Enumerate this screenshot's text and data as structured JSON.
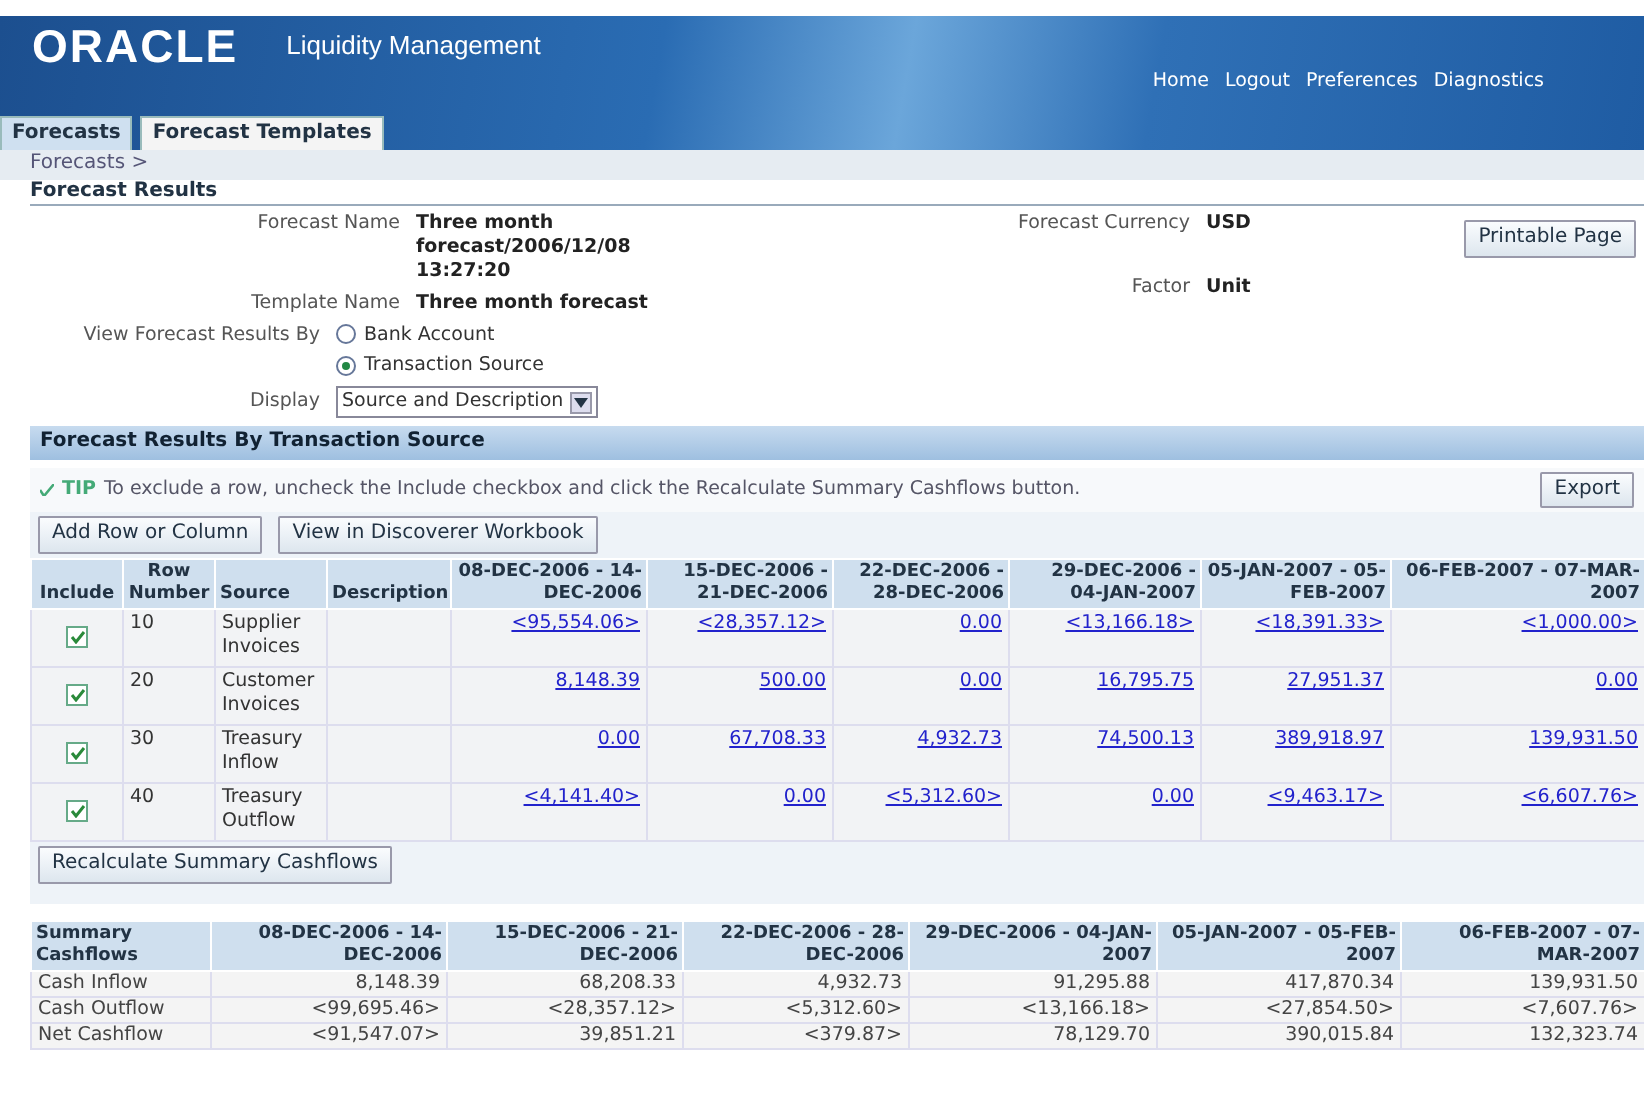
{
  "header": {
    "logo": "ORACLE",
    "app_title": "Liquidity Management",
    "global_links": [
      "Home",
      "Logout",
      "Preferences",
      "Diagnostics"
    ]
  },
  "tabs": [
    {
      "label": "Forecasts",
      "selected": true
    },
    {
      "label": "Forecast Templates",
      "selected": false
    }
  ],
  "breadcrumb": "Forecasts >",
  "page_title": "Forecast Results",
  "details": {
    "left": [
      {
        "label": "Forecast Name",
        "value": "Three month forecast/2006/12/08 13:27:20"
      },
      {
        "label": "Template Name",
        "value": "Three month forecast"
      }
    ],
    "right": [
      {
        "label": "Forecast Currency",
        "value": "USD"
      },
      {
        "label": "Factor",
        "value": "Unit"
      }
    ],
    "printable_button": "Printable Page",
    "view_by": {
      "label": "View Forecast Results By",
      "options": [
        {
          "label": "Bank Account",
          "selected": false
        },
        {
          "label": "Transaction Source",
          "selected": true
        }
      ]
    },
    "display": {
      "label": "Display",
      "value": "Source and Description"
    }
  },
  "section": {
    "title": "Forecast Results By Transaction Source",
    "tip_label": "TIP",
    "tip": "To exclude a row, uncheck the Include checkbox and click the Recalculate Summary Cashflows button.",
    "export_button": "Export",
    "buttons": [
      "Add Row or Column",
      "View in Discoverer Workbook"
    ],
    "table": {
      "columns": [
        "Include",
        "Row Number",
        "Source",
        "Description",
        "08-DEC-2006 - 14-DEC-2006",
        "15-DEC-2006 - 21-DEC-2006",
        "22-DEC-2006 - 28-DEC-2006",
        "29-DEC-2006 - 04-JAN-2007",
        "05-JAN-2007 - 05-FEB-2007",
        "06-FEB-2007 - 07-MAR-2007"
      ],
      "rows": [
        {
          "checked": true,
          "row_number": "10",
          "source": "Supplier Invoices",
          "values": [
            "<95,554.06>",
            "<28,357.12>",
            "0.00",
            "<13,166.18>",
            "<18,391.33>",
            "<1,000.00>"
          ]
        },
        {
          "checked": true,
          "row_number": "20",
          "source": "Customer Invoices",
          "values": [
            "8,148.39",
            "500.00",
            "0.00",
            "16,795.75",
            "27,951.37",
            "0.00"
          ]
        },
        {
          "checked": true,
          "row_number": "30",
          "source": "Treasury Inflow",
          "values": [
            "0.00",
            "67,708.33",
            "4,932.73",
            "74,500.13",
            "389,918.97",
            "139,931.50"
          ]
        },
        {
          "checked": true,
          "row_number": "40",
          "source": "Treasury Outflow",
          "values": [
            "<4,141.40>",
            "0.00",
            "<5,312.60>",
            "0.00",
            "<9,463.17>",
            "<6,607.76>"
          ]
        }
      ]
    },
    "recalculate_button": "Recalculate Summary Cashflows"
  },
  "summary": {
    "columns": [
      "Summary Cashflows",
      "08-DEC-2006 - 14-DEC-2006",
      "15-DEC-2006 - 21-DEC-2006",
      "22-DEC-2006 - 28-DEC-2006",
      "29-DEC-2006 - 04-JAN-2007",
      "05-JAN-2007 - 05-FEB-2007",
      "06-FEB-2007 - 07-MAR-2007"
    ],
    "rows": [
      {
        "label": "Cash Inflow",
        "values": [
          "8,148.39",
          "68,208.33",
          "4,932.73",
          "91,295.88",
          "417,870.34",
          "139,931.50"
        ]
      },
      {
        "label": "Cash Outflow",
        "values": [
          "<99,695.46>",
          "<28,357.12>",
          "<5,312.60>",
          "<13,166.18>",
          "<27,854.50>",
          "<7,607.76>"
        ]
      },
      {
        "label": "Net Cashflow",
        "values": [
          "<91,547.07>",
          "39,851.21",
          "<379.87>",
          "78,129.70",
          "390,015.84",
          "132,323.74"
        ]
      }
    ]
  }
}
